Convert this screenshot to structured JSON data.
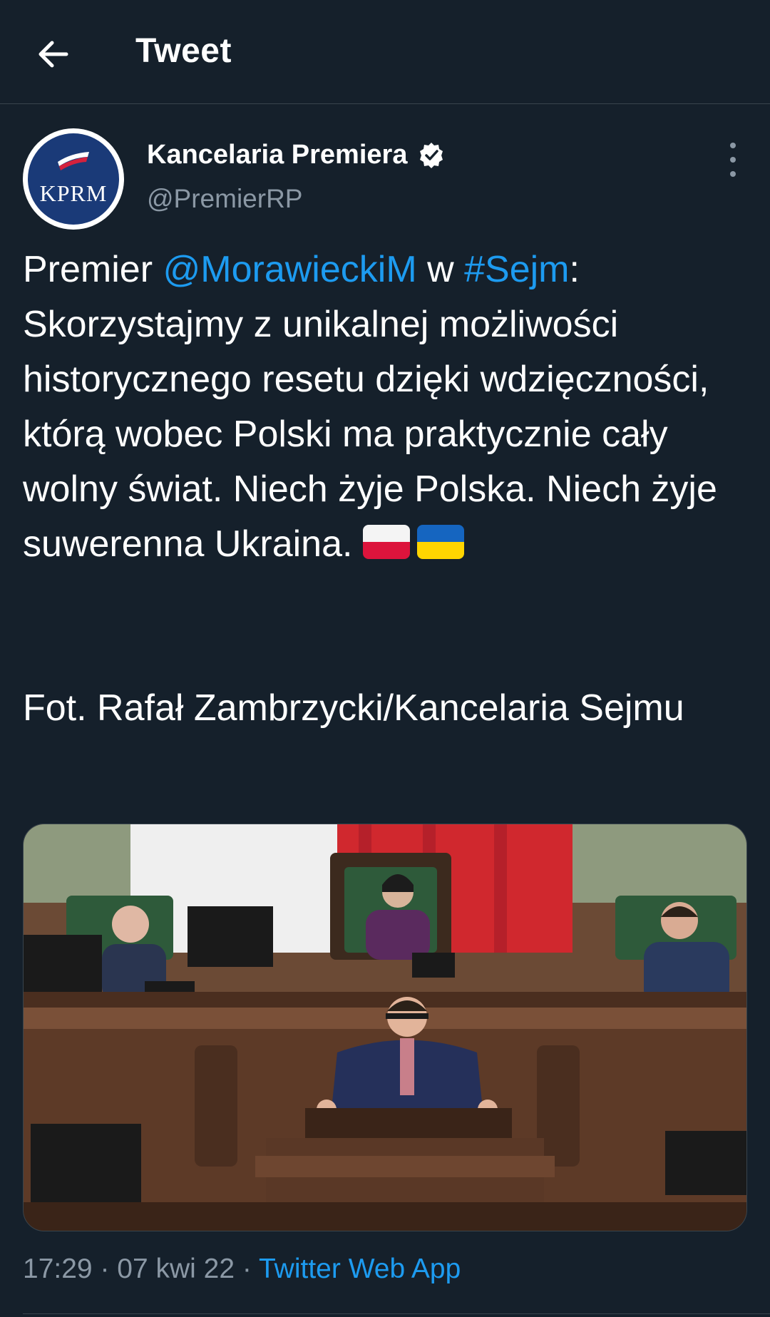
{
  "header": {
    "title": "Tweet",
    "back_icon": "arrow-left-icon"
  },
  "author": {
    "avatar_text": "KPRM",
    "name": "Kancelaria Premiera",
    "verified": true,
    "handle": "@PremierRP"
  },
  "tweet": {
    "segments": [
      {
        "text": "Premier ",
        "link": false
      },
      {
        "text": "@MorawieckiM",
        "link": true
      },
      {
        "text": " w ",
        "link": false
      },
      {
        "text": "#Sejm",
        "link": true
      },
      {
        "text": ": Skorzystajmy z unikalnej możliwości historycznego resetu dzięki wdzięczności, którą wobec Polski ma praktycznie cały wolny świat. Niech żyje Polska. Niech żyje suwerenna Ukraina. ",
        "link": false
      }
    ],
    "flags": [
      "poland-flag-emoji",
      "ukraine-flag-emoji"
    ],
    "credit": "Fot. Rafał Zambrzycki/Kancelaria Sejmu"
  },
  "meta": {
    "time": "17:29",
    "sep1": " · ",
    "date": "07 kwi 22",
    "sep2": " · ",
    "app": "Twitter Web App"
  },
  "colors": {
    "background": "#15202b",
    "link": "#1d9bf0",
    "secondary_text": "#8b98a5",
    "divider": "#38444d"
  }
}
